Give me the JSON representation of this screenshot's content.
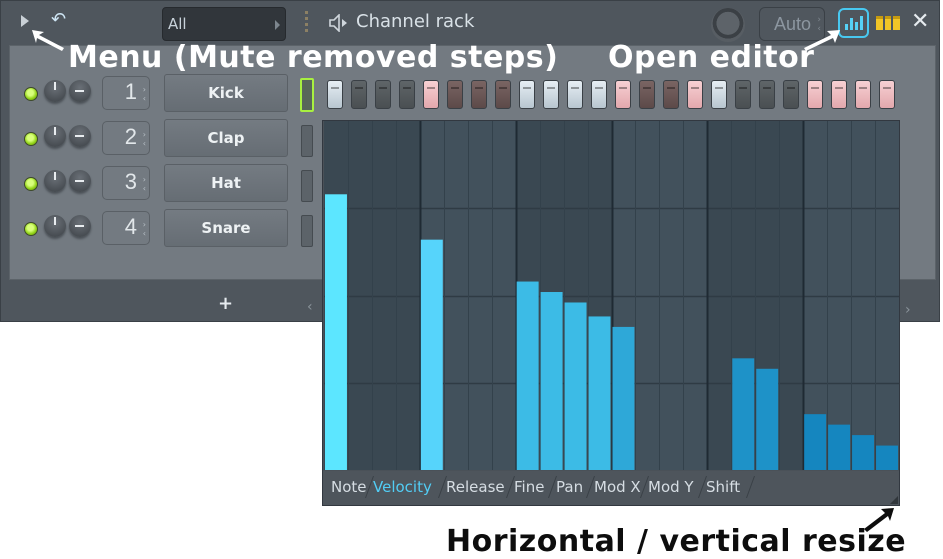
{
  "window": {
    "title": "Channel rack",
    "pattern_selector": {
      "value": "All"
    },
    "auto_button": {
      "label": "Auto"
    },
    "close_icon": "close-icon",
    "menu_icon": "triangle-right-icon",
    "undo_icon": "undo-icon",
    "speaker_icon": "speaker-icon",
    "swing_knob_icon": "knob-icon",
    "graph_editor_icon": "bar-graph-icon",
    "piano_roll_icon": "piano-keys-icon",
    "add_channel_label": "+"
  },
  "channels": [
    {
      "index": "1",
      "name": "Kick",
      "led_on": true,
      "selected": true
    },
    {
      "index": "2",
      "name": "Clap",
      "led_on": true,
      "selected": false
    },
    {
      "index": "3",
      "name": "Hat",
      "led_on": true,
      "selected": false
    },
    {
      "index": "4",
      "name": "Snare",
      "led_on": true,
      "selected": false
    }
  ],
  "steps": [
    {
      "group": "g",
      "on": true
    },
    {
      "group": "g",
      "on": false
    },
    {
      "group": "g",
      "on": false
    },
    {
      "group": "g",
      "on": false
    },
    {
      "group": "p",
      "on": true
    },
    {
      "group": "p",
      "on": false
    },
    {
      "group": "p",
      "on": false
    },
    {
      "group": "p",
      "on": false
    },
    {
      "group": "g",
      "on": true
    },
    {
      "group": "g",
      "on": true
    },
    {
      "group": "g",
      "on": true
    },
    {
      "group": "g",
      "on": true
    },
    {
      "group": "p",
      "on": true
    },
    {
      "group": "p",
      "on": false
    },
    {
      "group": "p",
      "on": false
    },
    {
      "group": "p",
      "on": true
    },
    {
      "group": "g",
      "on": true
    },
    {
      "group": "g",
      "on": false
    },
    {
      "group": "g",
      "on": false
    },
    {
      "group": "g",
      "on": false
    },
    {
      "group": "p",
      "on": true
    },
    {
      "group": "p",
      "on": true
    },
    {
      "group": "p",
      "on": true
    },
    {
      "group": "p",
      "on": true
    }
  ],
  "editor": {
    "tabs": [
      "Note",
      "Velocity",
      "Release",
      "Fine",
      "Pan",
      "Mod X",
      "Mod Y",
      "Shift"
    ],
    "active_tab": "Velocity",
    "velocity_levels": [
      0.79,
      0,
      0,
      0,
      0.66,
      0,
      0,
      0,
      0.54,
      0.51,
      0.48,
      0.44,
      0.41,
      0,
      0,
      0,
      0,
      0.32,
      0.29,
      0,
      0.16,
      0.13,
      0.1,
      0.07
    ]
  },
  "annotations": {
    "menu": "Menu (Mute removed steps)",
    "open_editor": "Open editor",
    "resize": "Horizontal / vertical resize"
  },
  "colors": {
    "accent": "#52cdf5",
    "led": "#93d418",
    "selected_channel": "#a8f040"
  }
}
